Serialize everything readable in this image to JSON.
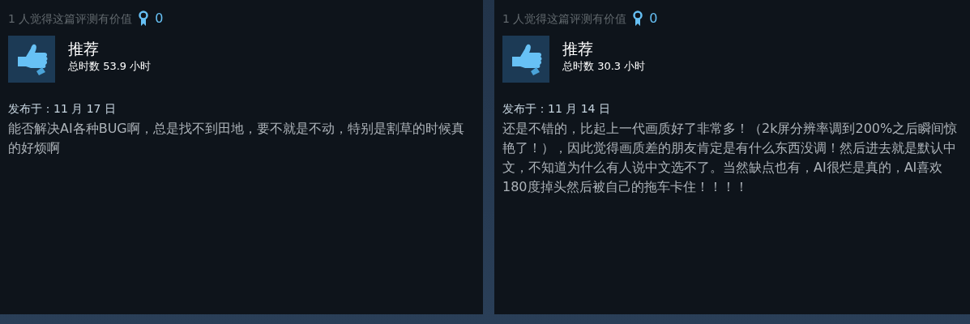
{
  "reviews": [
    {
      "helpful": "1 人觉得这篇评测有价值",
      "awards": "0",
      "verdict": "推荐",
      "hours": "总时数 53.9 小时",
      "posted": "发布于：11 月 17 日",
      "body": "能否解决AI各种BUG啊，总是找不到田地，要不就是不动，特别是割草的时候真的好烦啊"
    },
    {
      "helpful": "1 人觉得这篇评测有价值",
      "awards": "0",
      "verdict": "推荐",
      "hours": "总时数 30.3 小时",
      "posted": "发布于：11 月 14 日",
      "body": "还是不错的，比起上一代画质好了非常多！（2k屏分辨率调到200%之后瞬间惊艳了！），因此觉得画质差的朋友肯定是有什么东西没调！然后进去就是默认中文，不知道为什么有人说中文选不了。当然缺点也有，AI很烂是真的，AI喜欢180度掉头然后被自己的拖车卡住！！！！"
    }
  ]
}
